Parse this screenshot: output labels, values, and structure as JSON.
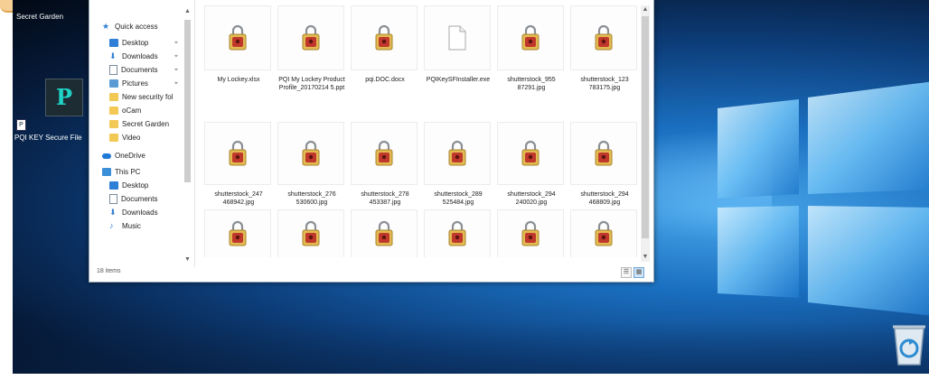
{
  "desktop": {
    "icons": [
      {
        "id": "secret_garden",
        "label": "Secret Garden"
      },
      {
        "id": "pq_app",
        "glyph": "P"
      },
      {
        "id": "pq_key_file",
        "label": "PQI KEY Secure File"
      }
    ],
    "recycle_bin": {
      "icon": "recycle-bin-icon"
    }
  },
  "explorer": {
    "nav": [
      {
        "label": "Quick access",
        "icon": "star-icon",
        "color": "#2f7fd6",
        "pinned": false
      },
      {
        "label": "Desktop",
        "icon": "desktop-folder-icon",
        "color": "#2f7fd6",
        "pinned": true
      },
      {
        "label": "Downloads",
        "icon": "download-arrow-icon",
        "color": "#2f7fd6",
        "pinned": true
      },
      {
        "label": "Documents",
        "icon": "documents-icon",
        "color": "#7a8a99",
        "pinned": true
      },
      {
        "label": "Pictures",
        "icon": "pictures-icon",
        "color": "#5a9bd5",
        "pinned": true
      },
      {
        "label": "New security fol",
        "icon": "folder-icon",
        "color": "#f2c955",
        "pinned": false
      },
      {
        "label": "oCam",
        "icon": "folder-icon",
        "color": "#f2c955",
        "pinned": false
      },
      {
        "label": "Secret Garden",
        "icon": "folder-icon",
        "color": "#f2c955",
        "pinned": false
      },
      {
        "label": "Video",
        "icon": "folder-icon",
        "color": "#f2c955",
        "pinned": false
      },
      {
        "label": "OneDrive",
        "icon": "onedrive-icon",
        "color": "#1e7ad6",
        "pinned": false
      },
      {
        "label": "This PC",
        "icon": "computer-icon",
        "color": "#3b8fd9",
        "pinned": false
      },
      {
        "label": "Desktop",
        "icon": "desktop-folder-icon",
        "color": "#2f7fd6",
        "pinned": false
      },
      {
        "label": "Documents",
        "icon": "documents-icon",
        "color": "#7a8a99",
        "pinned": false
      },
      {
        "label": "Downloads",
        "icon": "download-arrow-icon",
        "color": "#2f7fd6",
        "pinned": false
      },
      {
        "label": "Music",
        "icon": "music-icon",
        "color": "#2f7fd6",
        "pinned": false
      }
    ],
    "files": [
      {
        "name": "My Lockey.xlsx",
        "kind": "locked"
      },
      {
        "name": "PQI My Lockey Product Profile_20170214 5.ppt",
        "kind": "locked"
      },
      {
        "name": "pqi.DOC.docx",
        "kind": "locked"
      },
      {
        "name": "PQIKeySFInstaller.exe",
        "kind": "blank"
      },
      {
        "name": "shutterstock_955 87291.jpg",
        "kind": "locked"
      },
      {
        "name": "shutterstock_123 783175.jpg",
        "kind": "locked"
      },
      {
        "name": "shutterstock_247 468942.jpg",
        "kind": "locked"
      },
      {
        "name": "shutterstock_276 530600.jpg",
        "kind": "locked"
      },
      {
        "name": "shutterstock_278 453387.jpg",
        "kind": "locked"
      },
      {
        "name": "shutterstock_289 525484.jpg",
        "kind": "locked"
      },
      {
        "name": "shutterstock_294 240020.jpg",
        "kind": "locked"
      },
      {
        "name": "shutterstock_294 468809.jpg",
        "kind": "locked"
      },
      {
        "name": "",
        "kind": "locked"
      },
      {
        "name": "",
        "kind": "locked"
      },
      {
        "name": "",
        "kind": "locked"
      },
      {
        "name": "",
        "kind": "locked"
      },
      {
        "name": "",
        "kind": "locked"
      },
      {
        "name": "",
        "kind": "locked"
      }
    ],
    "status": {
      "item_count": "18 items"
    },
    "view_buttons": [
      {
        "icon": "details-view-icon",
        "active": false
      },
      {
        "icon": "large-icons-view-icon",
        "active": true
      }
    ]
  }
}
